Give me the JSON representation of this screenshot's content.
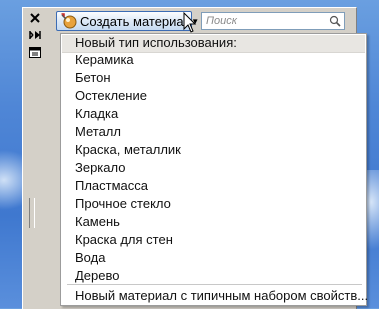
{
  "toolbar": {
    "create_label": "Создать материал",
    "search_placeholder": "Поиск"
  },
  "menu": {
    "header": "Новый тип использования:",
    "items": [
      "Керамика",
      "Бетон",
      "Остекление",
      "Кладка",
      "Металл",
      "Краска, металлик",
      "Зеркало",
      "Пластмасса",
      "Прочное стекло",
      "Камень",
      "Краска для стен",
      "Вода",
      "Дерево"
    ],
    "footer": "Новый материал с типичным набором свойств..."
  }
}
